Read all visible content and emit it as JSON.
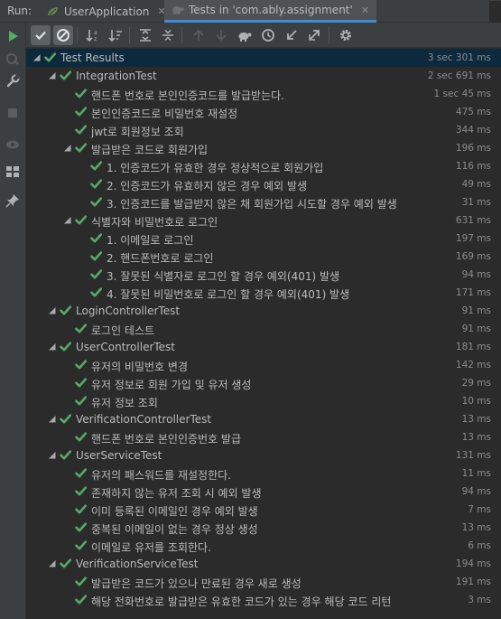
{
  "run_label": "Run:",
  "tabs": [
    {
      "label": "UserApplication",
      "icon": "spring-app-icon",
      "active": false
    },
    {
      "label": "Tests in 'com.ably.assignment'",
      "icon": "test-turtle-icon",
      "active": true
    }
  ],
  "tree": [
    {
      "label": "Test Results",
      "time": "3 sec 301 ms",
      "level": 0,
      "expanded": true,
      "selected": true
    },
    {
      "label": "IntegrationTest",
      "time": "2 sec 691 ms",
      "level": 1,
      "expanded": true
    },
    {
      "label": "핸드폰 번호로 본인인증코드를 발급받는다.",
      "time": "1 sec 45 ms",
      "level": 2
    },
    {
      "label": "본인인증코드로 비밀번호 재설정",
      "time": "475 ms",
      "level": 2
    },
    {
      "label": "jwt로 회원정보 조회",
      "time": "344 ms",
      "level": 2
    },
    {
      "label": "발급받은 코드로 회원가입",
      "time": "196 ms",
      "level": 2,
      "expanded": true
    },
    {
      "label": "1. 인증코드가 유효한 경우 정상적으로 회원가입",
      "time": "116 ms",
      "level": 3
    },
    {
      "label": "2. 인증코드가 유효하지 않은 경우 예외 발생",
      "time": "49 ms",
      "level": 3
    },
    {
      "label": "3. 인증코드를 발급받지 않은 채 회원가입 시도할 경우 예외 발생",
      "time": "31 ms",
      "level": 3
    },
    {
      "label": "식별자와 비밀번호로 로그인",
      "time": "631 ms",
      "level": 2,
      "expanded": true
    },
    {
      "label": "1. 이메일로 로그인",
      "time": "197 ms",
      "level": 3
    },
    {
      "label": "2. 핸드폰번호로 로그인",
      "time": "169 ms",
      "level": 3
    },
    {
      "label": "3. 잘못된 식별자로 로그인 할 경우 예외(401) 발생",
      "time": "94 ms",
      "level": 3
    },
    {
      "label": "4. 잘못된 비밀번호로 로그인 할 경우 예외(401) 발생",
      "time": "171 ms",
      "level": 3
    },
    {
      "label": "LoginControllerTest",
      "time": "91 ms",
      "level": 1,
      "expanded": true
    },
    {
      "label": "로그인 테스트",
      "time": "91 ms",
      "level": 2
    },
    {
      "label": "UserControllerTest",
      "time": "181 ms",
      "level": 1,
      "expanded": true
    },
    {
      "label": "유저의 비밀번호 변경",
      "time": "142 ms",
      "level": 2
    },
    {
      "label": "유저 정보로 회원 가입 및 유저 생성",
      "time": "29 ms",
      "level": 2
    },
    {
      "label": "유저 정보 조회",
      "time": "10 ms",
      "level": 2
    },
    {
      "label": "VerificationControllerTest",
      "time": "13 ms",
      "level": 1,
      "expanded": true
    },
    {
      "label": "핸드폰 번호로 본인인증번호 발급",
      "time": "13 ms",
      "level": 2
    },
    {
      "label": "UserServiceTest",
      "time": "131 ms",
      "level": 1,
      "expanded": true
    },
    {
      "label": "유저의 패스워드를 재설정한다.",
      "time": "11 ms",
      "level": 2
    },
    {
      "label": "존재하지 않는 유저 조회 시 예외 발생",
      "time": "94 ms",
      "level": 2
    },
    {
      "label": "이미 등록된 이메일인 경우 예외 발생",
      "time": "7 ms",
      "level": 2
    },
    {
      "label": "중복된 이메일이 없는 경우 정상 생성",
      "time": "13 ms",
      "level": 2
    },
    {
      "label": "이메일로 유저를 조회한다.",
      "time": "6 ms",
      "level": 2
    },
    {
      "label": "VerificationServiceTest",
      "time": "194 ms",
      "level": 1,
      "expanded": true
    },
    {
      "label": "발급받은 코드가 있으나 만료된 경우 새로 생성",
      "time": "191 ms",
      "level": 2
    },
    {
      "label": "해당 전화번호로 발급받은 유효한 코드가 있는 경우 해당 코드 리턴",
      "time": "3 ms",
      "level": 2
    }
  ],
  "colors": {
    "pass": "#59a869",
    "accent": "#4a88c7",
    "background": "#2b2b2b",
    "panel": "#3c3f41"
  }
}
